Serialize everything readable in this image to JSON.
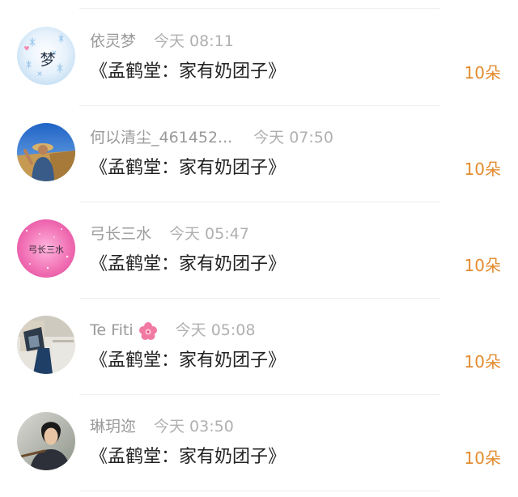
{
  "colors": {
    "name": "#9a9a9a",
    "time": "#b0b0b0",
    "text": "#222222",
    "gift": "#e38b2f",
    "divider": "#efefef"
  },
  "comments": [
    {
      "user": "依灵梦",
      "time": "今天 08:11",
      "content": "《孟鹤堂：家有奶团子》",
      "gift": "10朵",
      "avatar_text": "梦"
    },
    {
      "user": "何以清尘_461452...",
      "time": "今天 07:50",
      "content": "《孟鹤堂：家有奶团子》",
      "gift": "10朵"
    },
    {
      "user": "弓长三水",
      "time": "今天 05:47",
      "content": "《孟鹤堂：家有奶团子》",
      "gift": "10朵",
      "avatar_text": "弓长三水"
    },
    {
      "user": "Te Fiti",
      "badge_icon": "flower-icon",
      "time": "今天 05:08",
      "content": "《孟鹤堂：家有奶团子》",
      "gift": "10朵"
    },
    {
      "user": "琳玥迩",
      "time": "今天 03:50",
      "content": "《孟鹤堂：家有奶团子》",
      "gift": "10朵"
    }
  ]
}
